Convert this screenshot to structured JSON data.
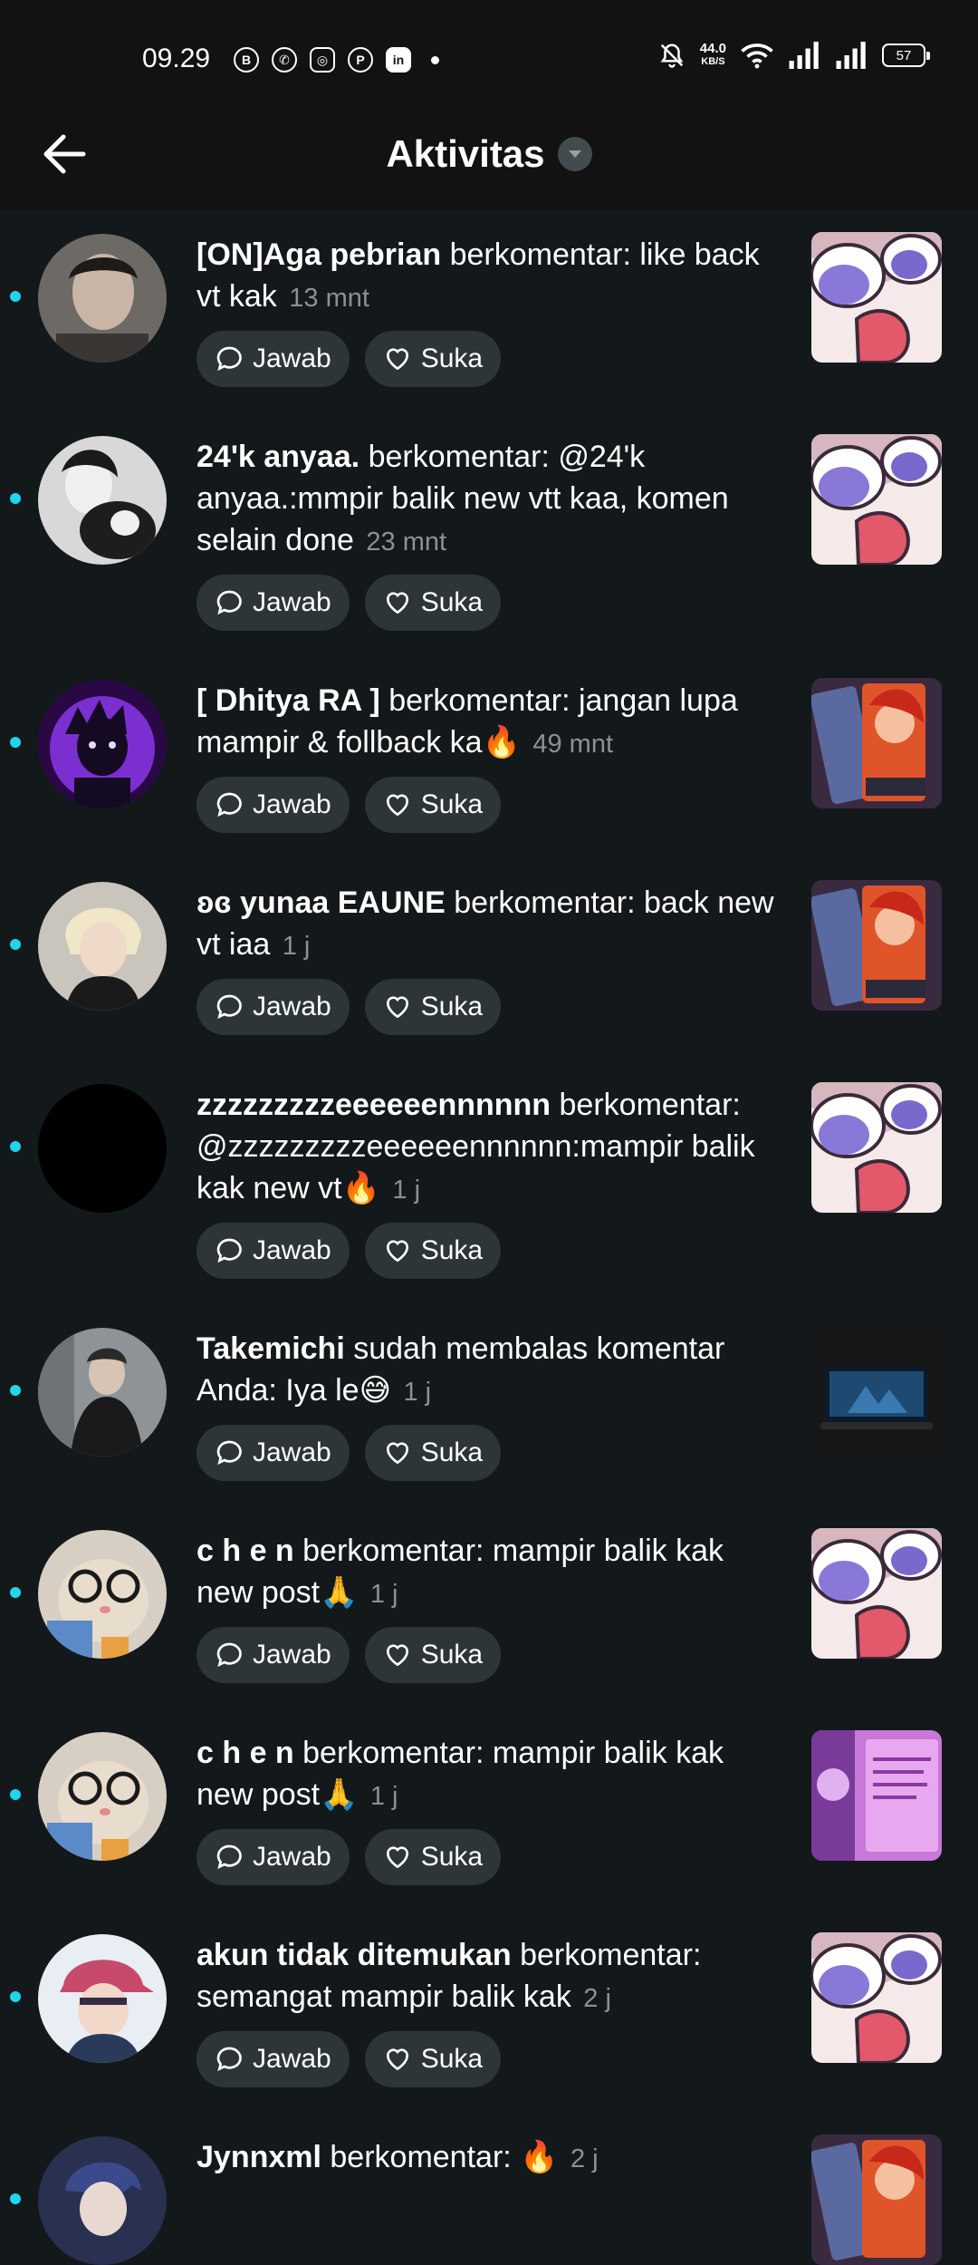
{
  "status_bar": {
    "time": "09.29",
    "left_icons": [
      "b-icon",
      "whatsapp-icon",
      "instagram-icon",
      "pinterest-icon",
      "linkedin-icon"
    ],
    "speed": "44.0",
    "speed_unit": "KB/S",
    "battery": "57"
  },
  "header": {
    "title": "Aktivitas"
  },
  "actions": {
    "reply_label": "Jawab",
    "like_label": "Suka"
  },
  "colors": {
    "background": "#13191b",
    "unread_dot": "#20d5ec",
    "pill_bg": "#2d3538"
  },
  "items": [
    {
      "username": "[ON]Aga pebrian",
      "message": " berkomentar: like back vt kak",
      "time": "13 mnt"
    },
    {
      "username": "24'k anyaa.",
      "message": " berkomentar: @24'k anyaa.:mmpir balik new vtt kaa, komen selain done",
      "time": "23 mnt"
    },
    {
      "username": "[ Dhitya RA ]",
      "message": " berkomentar: jangan lupa mampir & follback ka🔥",
      "time": "49 mnt"
    },
    {
      "username": "ʚɞ yunaa EAUNE",
      "message": " berkomentar: back new vt iaa",
      "time": "1 j"
    },
    {
      "username": "zzzzzzzzzeeeeeennnnnn",
      "message": " berkomentar: @zzzzzzzzzeeeeeennnnnn:mampir balik kak new vt🔥",
      "time": "1 j"
    },
    {
      "username": "Takemichi",
      "message": " sudah membalas komentar Anda: Iya le😅",
      "time": "1 j"
    },
    {
      "username": "c h e n",
      "message": " berkomentar: mampir balik kak new post🙏",
      "time": "1 j"
    },
    {
      "username": "c h e n",
      "message": " berkomentar: mampir balik kak new post🙏",
      "time": "1 j"
    },
    {
      "username": "akun tidak ditemukan",
      "message": " berkomentar: semangat mampir balik kak",
      "time": "2 j"
    },
    {
      "username": "Jynnxml",
      "message": " berkomentar: 🔥",
      "time": "2 j"
    }
  ]
}
